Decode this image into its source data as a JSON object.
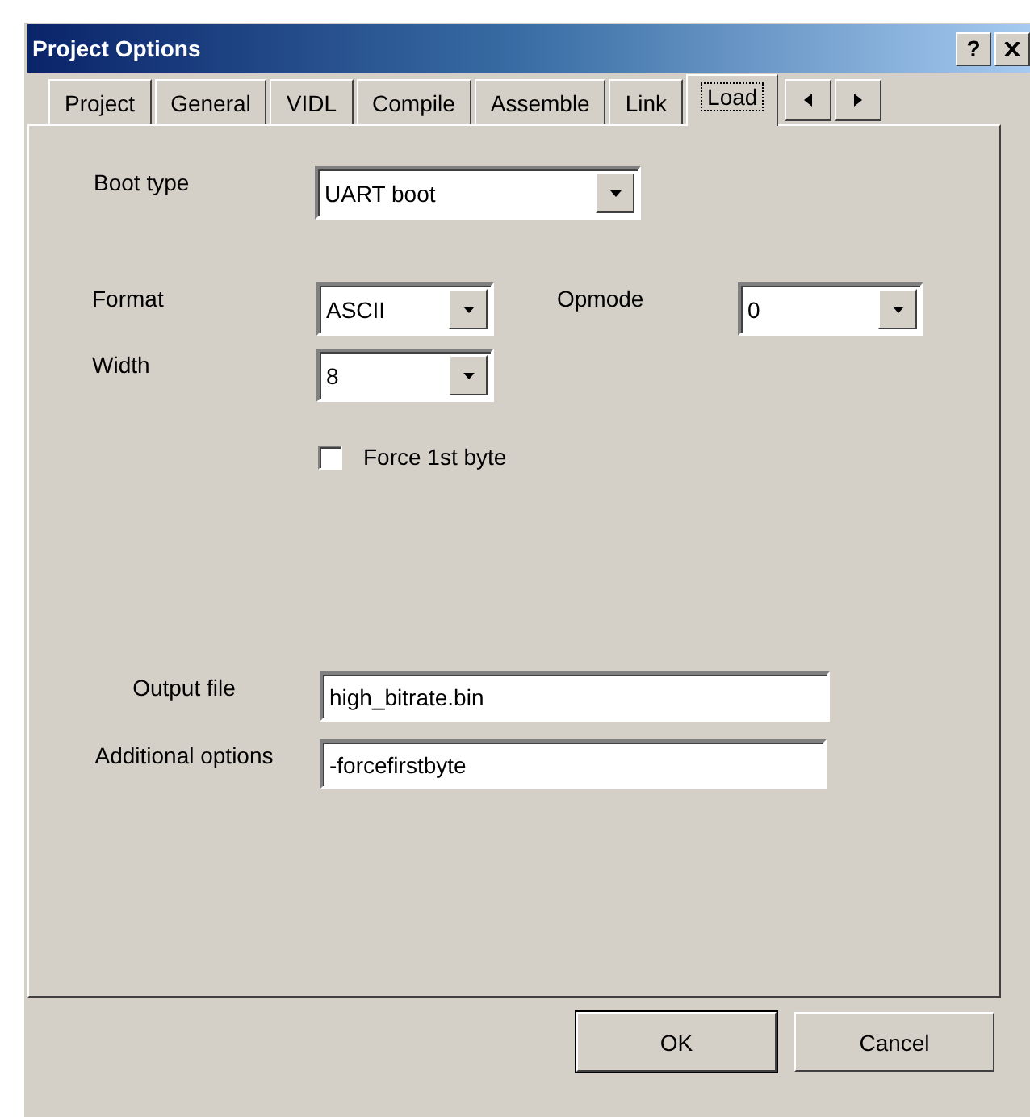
{
  "window": {
    "title": "Project Options",
    "help_button": "?"
  },
  "tabs": [
    {
      "label": "Project",
      "selected": false
    },
    {
      "label": "General",
      "selected": false
    },
    {
      "label": "VIDL",
      "selected": false
    },
    {
      "label": "Compile",
      "selected": false
    },
    {
      "label": "Assemble",
      "selected": false
    },
    {
      "label": "Link",
      "selected": false
    },
    {
      "label": "Load",
      "selected": true
    }
  ],
  "boot_type": {
    "label": "Boot type",
    "value": "UART boot"
  },
  "format": {
    "label": "Format",
    "value": "ASCII"
  },
  "opmode": {
    "label": "Opmode",
    "value": "0"
  },
  "width": {
    "label": "Width",
    "value": "8"
  },
  "force_first_byte": {
    "label": "Force 1st byte",
    "checked": false
  },
  "output_file": {
    "label": "Output file",
    "value": "high_bitrate.bin"
  },
  "additional_options": {
    "label": "Additional options",
    "value": "-forcefirstbyte"
  },
  "buttons": [
    {
      "label": "OK",
      "default": true
    },
    {
      "label": "Cancel",
      "default": false
    }
  ]
}
